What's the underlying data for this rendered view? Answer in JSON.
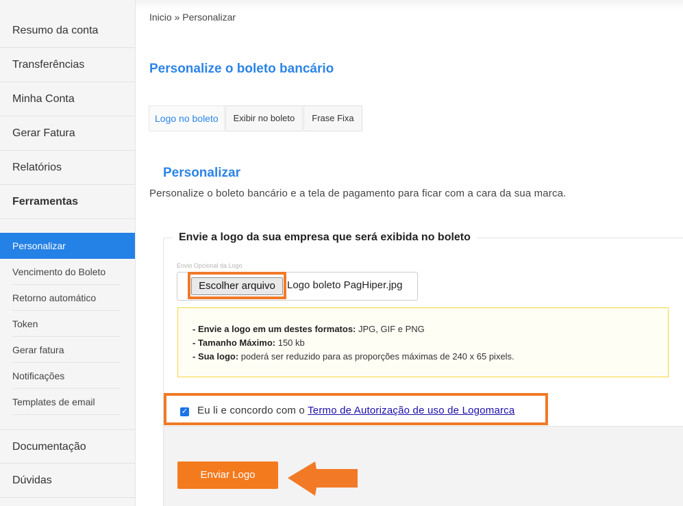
{
  "sidebar": {
    "items": [
      {
        "label": "Resumo da conta"
      },
      {
        "label": "Transferências"
      },
      {
        "label": "Minha Conta"
      },
      {
        "label": "Gerar Fatura"
      },
      {
        "label": "Relatórios"
      },
      {
        "label": "Ferramentas"
      }
    ],
    "sub_items": [
      {
        "label": "Personalizar"
      },
      {
        "label": "Vencimento do Boleto"
      },
      {
        "label": "Retorno automático"
      },
      {
        "label": "Token"
      },
      {
        "label": "Gerar fatura"
      },
      {
        "label": "Notificações"
      },
      {
        "label": "Templates de email"
      }
    ],
    "bottom_items": [
      {
        "label": "Documentação"
      },
      {
        "label": "Dúvidas"
      }
    ]
  },
  "breadcrumb": "Inicio » Personalizar",
  "page_title": "Personalize o boleto bancário",
  "tabs": [
    {
      "label": "Logo no boleto"
    },
    {
      "label": "Exibir no boleto"
    },
    {
      "label": "Frase Fixa"
    }
  ],
  "section": {
    "title": "Personalizar",
    "description": "Personalize o boleto bancário e a tela de pagamento para ficar com a cara da sua marca."
  },
  "upload": {
    "legend": "Envie a logo da sua empresa que será exibida no boleto",
    "caption": "Envio Opcional da Logo",
    "button_label": "Escolher arquivo",
    "file_name": "Logo boleto PagHiper.jpg"
  },
  "notice": {
    "line1_bold": "- Envie a logo em um destes formatos:",
    "line1_text": " JPG, GIF e PNG",
    "line2_bold": "- Tamanho Máximo:",
    "line2_text": " 150 kb",
    "line3_bold": "- Sua logo:",
    "line3_text": " poderá ser reduzido para as proporções máximas de 240 x 65 pixels."
  },
  "agreement": {
    "checked": true,
    "text": "Eu li e concordo com o ",
    "link": "Termo de Autorização de uso de Logomarca"
  },
  "submit_label": "Enviar Logo",
  "colors": {
    "accent_blue": "#2c84e8",
    "highlight_orange": "#f07a28",
    "button_orange": "#f47a1e",
    "notice_border": "#f5d63d"
  }
}
